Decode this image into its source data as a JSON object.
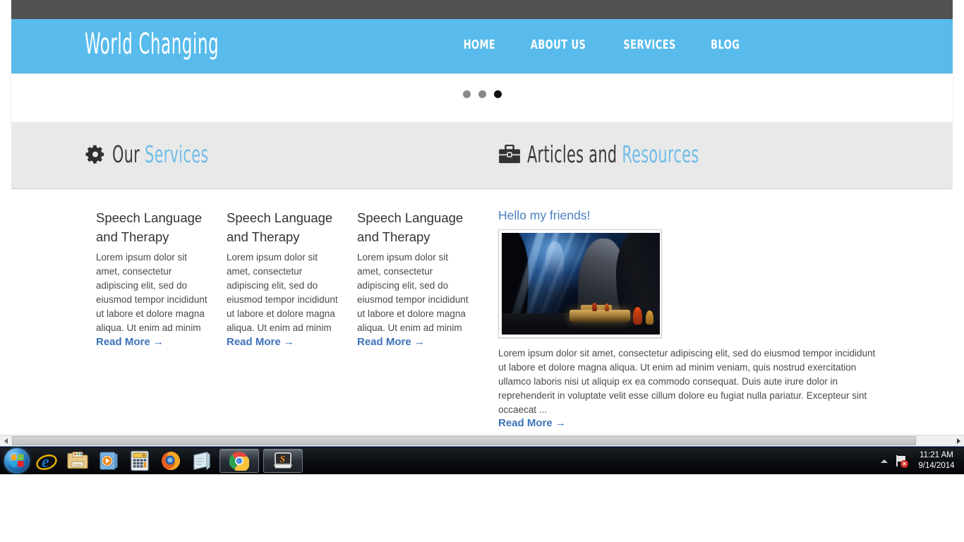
{
  "site": {
    "brand": "World Changing",
    "nav": [
      {
        "label": "HOME"
      },
      {
        "label": "ABOUT US"
      },
      {
        "label": "SERVICES"
      },
      {
        "label": "BLOG"
      }
    ],
    "slider": {
      "dots": [
        {
          "state": "inactive"
        },
        {
          "state": "inactive"
        },
        {
          "state": "active"
        }
      ]
    },
    "sections": {
      "services": {
        "icon": "gear-icon",
        "title_dark": "Our",
        "title_blue": "Services"
      },
      "articles": {
        "icon": "briefcase-icon",
        "title_dark": "Articles and",
        "title_blue": "Resources"
      }
    },
    "service_cards": [
      {
        "title": "Speech Language and Therapy",
        "body": "Lorem ipsum dolor sit amet, consectetur adipiscing elit, sed do eiusmod tempor incididunt ut labore et dolore magna aliqua. Ut enim ad minim",
        "read_more": "Read More →"
      },
      {
        "title": "Speech Language and Therapy",
        "body": "Lorem ipsum dolor sit amet, consectetur adipiscing elit, sed do eiusmod tempor incididunt ut labore et dolore magna aliqua. Ut enim ad minim",
        "read_more": "Read More →"
      },
      {
        "title": "Speech Language and Therapy",
        "body": "Lorem ipsum dolor sit amet, consectetur adipiscing elit, sed do eiusmod tempor incididunt ut labore et dolore magna aliqua. Ut enim ad minim",
        "read_more": "Read More →"
      }
    ],
    "article": {
      "title": "Hello my friends!",
      "image_alt": "cave-interior-with-light-rays-photo",
      "body": "Lorem ipsum dolor sit amet, consectetur adipiscing elit, sed do eiusmod tempor incididunt ut labore et dolore magna aliqua. Ut enim ad minim veniam, quis nostrud exercitation ullamco laboris nisi ut aliquip ex ea commodo consequat. Duis aute irure dolor in reprehenderit in voluptate velit esse cillum dolore eu fugiat nulla pariatur. Excepteur sint occaecat ...",
      "read_more": "Read More →"
    },
    "colors": {
      "header_blue": "#58bbec",
      "topbar_dark": "#515151",
      "section_gray": "#e9e9e9",
      "link_blue": "#3b73b9",
      "title_blue": "#4a7fc1",
      "accent_blue": "#6fbde8"
    }
  },
  "taskbar": {
    "start": {
      "name": "start-button"
    },
    "items": [
      {
        "icon": "internet-explorer-icon",
        "label": "Internet Explorer"
      },
      {
        "icon": "windows-explorer-icon",
        "label": "Windows Explorer"
      },
      {
        "icon": "windows-media-player-icon",
        "label": "Windows Media Player"
      },
      {
        "icon": "calculator-icon",
        "label": "Calculator"
      },
      {
        "icon": "firefox-icon",
        "label": "Mozilla Firefox"
      },
      {
        "icon": "notepad-icon",
        "label": "Notepad"
      },
      {
        "icon": "google-chrome-icon",
        "label": "Google Chrome"
      },
      {
        "icon": "s-app-icon",
        "label": "S"
      }
    ],
    "tray": {
      "show_hidden": "show-hidden-icons",
      "network": "network-error-icon",
      "network_badge": "✕",
      "time": "11:21 AM",
      "date": "9/14/2014"
    }
  }
}
